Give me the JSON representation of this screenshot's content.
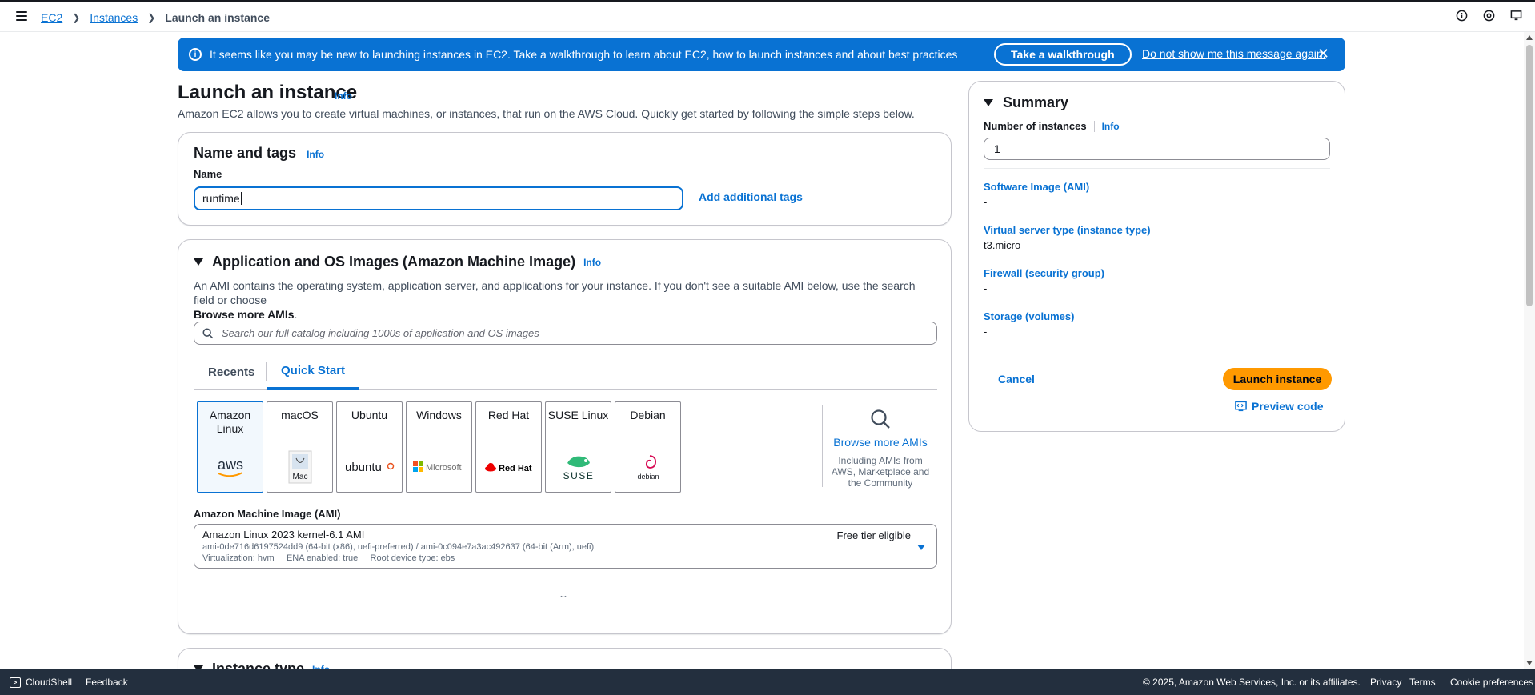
{
  "breadcrumb": {
    "items": [
      "EC2",
      "Instances"
    ],
    "current": "Launch an instance"
  },
  "banner": {
    "message": "It seems like you may be new to launching instances in EC2. Take a walkthrough to learn about EC2, how to launch instances and about best practices",
    "walkthrough_button": "Take a walkthrough",
    "dismiss_link": "Do not show me this message again.",
    "color": "#0972d3"
  },
  "page": {
    "title": "Launch an instance",
    "info": "Info",
    "description": "Amazon EC2 allows you to create virtual machines, or instances, that run on the AWS Cloud. Quickly get started by following the simple steps below."
  },
  "name_tags": {
    "heading": "Name and tags",
    "info": "Info",
    "name_label": "Name",
    "name_value": "runtime",
    "add_tags": "Add additional tags"
  },
  "ami": {
    "heading": "Application and OS Images (Amazon Machine Image)",
    "info": "Info",
    "description_pre": "An AMI contains the operating system, application server, and applications for your instance. If you don't see a suitable AMI below, use the search field or choose",
    "description_bold": "Browse more AMIs",
    "description_post": ".",
    "search_placeholder": "Search our full catalog including 1000s of application and OS images",
    "tabs": [
      "Recents",
      "Quick Start"
    ],
    "active_tab": "Quick Start",
    "os_options": [
      {
        "name": "Amazon Linux",
        "logo": "aws"
      },
      {
        "name": "macOS",
        "logo": "Mac"
      },
      {
        "name": "Ubuntu",
        "logo": "ubuntu"
      },
      {
        "name": "Windows",
        "logo": "Microsoft"
      },
      {
        "name": "Red Hat",
        "logo": "Red Hat"
      },
      {
        "name": "SUSE Linux",
        "logo": "SUSE"
      },
      {
        "name": "Debian",
        "logo": "debian"
      }
    ],
    "selected_os": "Amazon Linux",
    "browse_more": "Browse more AMIs",
    "browse_sub": "Including AMIs from AWS, Marketplace and the Community",
    "ami_label": "Amazon Machine Image (AMI)",
    "ami_selected": {
      "name": "Amazon Linux 2023 kernel-6.1 AMI",
      "ids": "ami-0de716d6197524dd9 (64-bit (x86), uefi-preferred) / ami-0c094e7a3ac492637 (64-bit (Arm), uefi)",
      "details": "Virtualization: hvm     ENA enabled: true     Root device type: ebs",
      "badge": "Free tier eligible"
    }
  },
  "instance_type": {
    "heading": "Instance type",
    "info": "Info"
  },
  "summary": {
    "heading": "Summary",
    "instances_label": "Number of instances",
    "info": "Info",
    "instances_value": "1",
    "items": [
      {
        "key": "Software Image (AMI)",
        "value": "-"
      },
      {
        "key": "Virtual server type (instance type)",
        "value": "t3.micro"
      },
      {
        "key": "Firewall (security group)",
        "value": "-"
      },
      {
        "key": "Storage (volumes)",
        "value": "-"
      }
    ],
    "cancel": "Cancel",
    "launch": "Launch instance",
    "preview": "Preview code",
    "launch_color": "#ff9900"
  },
  "footer": {
    "cloudshell": "CloudShell",
    "feedback": "Feedback",
    "copyright": "© 2025, Amazon Web Services, Inc. or its affiliates.",
    "links": [
      "Privacy",
      "Terms",
      "Cookie preferences"
    ]
  }
}
